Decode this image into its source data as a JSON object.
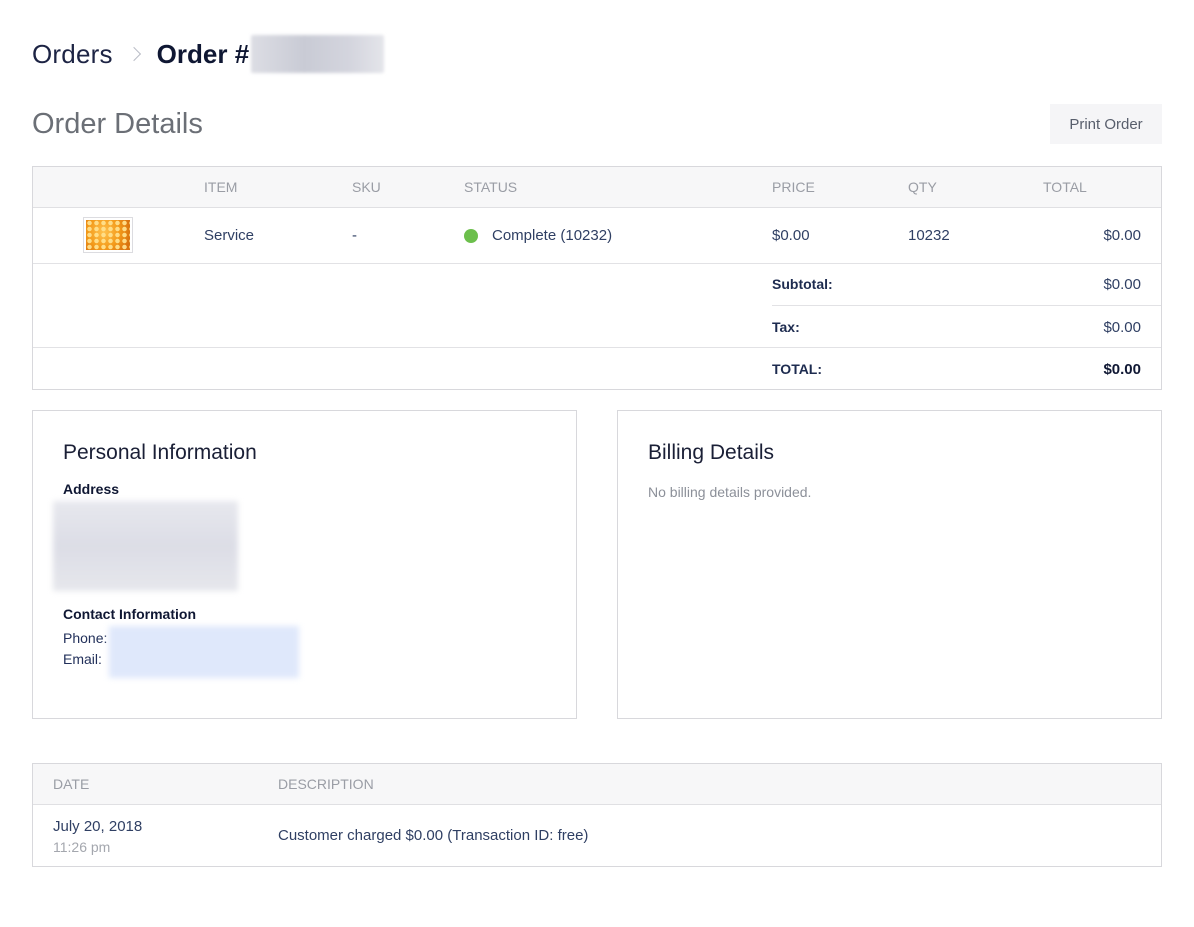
{
  "breadcrumb": {
    "orders": "Orders",
    "current_prefix": "Order #"
  },
  "page_title": "Order Details",
  "print_button": "Print Order",
  "items_table": {
    "headers": {
      "item": "ITEM",
      "sku": "SKU",
      "status": "STATUS",
      "price": "PRICE",
      "qty": "QTY",
      "total": "TOTAL"
    },
    "rows": [
      {
        "item": "Service",
        "sku": "-",
        "status": "Complete (10232)",
        "status_color": "#6cbf4c",
        "price": "$0.00",
        "qty": "10232",
        "total": "$0.00"
      }
    ],
    "summary": {
      "subtotal_label": "Subtotal:",
      "subtotal": "$0.00",
      "tax_label": "Tax:",
      "tax": "$0.00",
      "total_label": "TOTAL:",
      "total": "$0.00"
    }
  },
  "personal": {
    "title": "Personal Information",
    "address_label": "Address",
    "contact_label": "Contact Information",
    "phone_label": "Phone:",
    "email_label": "Email:"
  },
  "billing": {
    "title": "Billing Details",
    "empty": "No billing details provided."
  },
  "transactions": {
    "headers": {
      "date": "DATE",
      "description": "DESCRIPTION"
    },
    "rows": [
      {
        "date": "July 20, 2018",
        "time": "11:26 pm",
        "description": "Customer charged $0.00 (Transaction ID: free)"
      }
    ]
  }
}
